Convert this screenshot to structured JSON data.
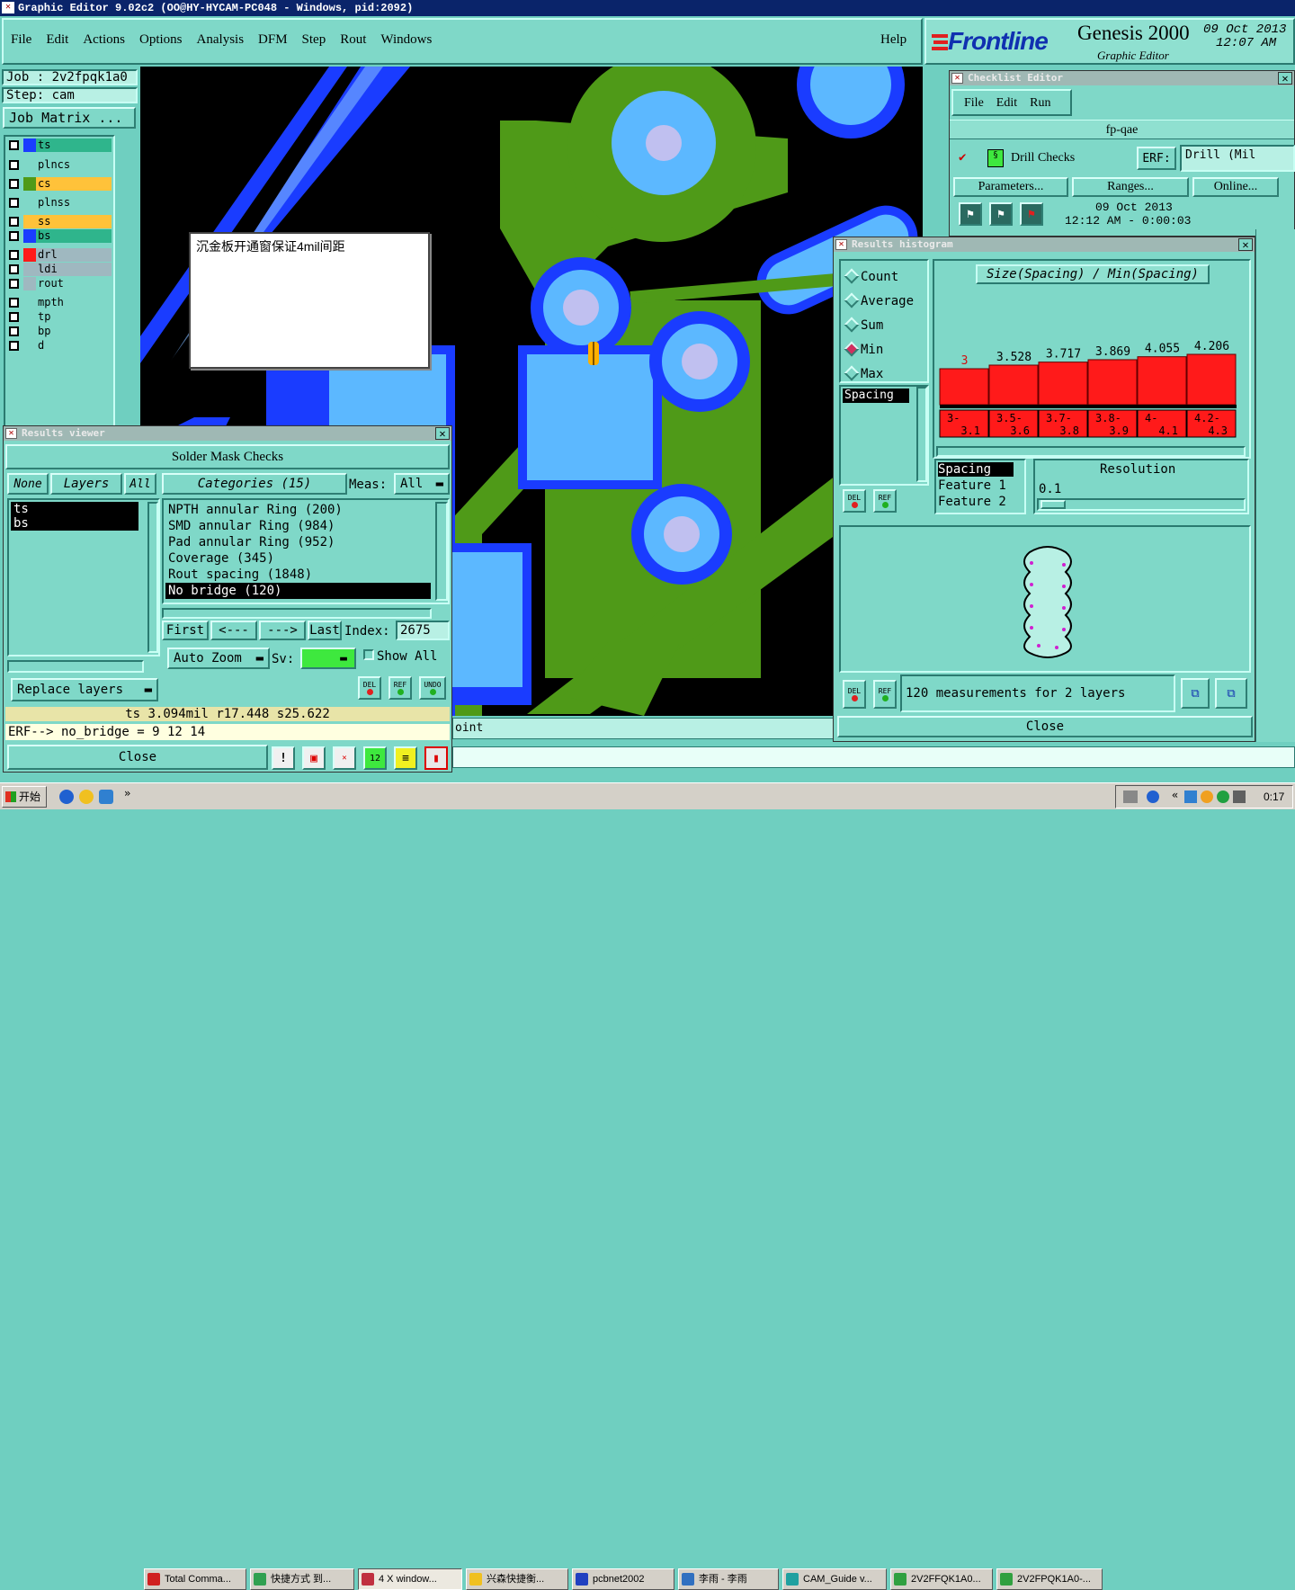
{
  "window": {
    "title": "Graphic Editor 9.02c2 (OO@HY-HYCAM-PC048 - Windows, pid:2092)"
  },
  "menu": [
    "File",
    "Edit",
    "Actions",
    "Options",
    "Analysis",
    "DFM",
    "Step",
    "Rout",
    "Windows"
  ],
  "help": "Help",
  "brand": {
    "logo": "Frontline",
    "product": "Genesis 2000",
    "subtitle": "Graphic Editor",
    "date": "09 Oct 2013",
    "time": "12:07 AM"
  },
  "job": {
    "job": "Job : 2v2fpqk1a0",
    "step": "Step: cam",
    "matrix": "Job Matrix ..."
  },
  "layers": [
    {
      "name": "ts",
      "sw": "#1a3cff",
      "bg": "#2fb58c"
    },
    {
      "name": "plncs",
      "sw": "#7fd8c8",
      "bg": "#7fd8c8"
    },
    {
      "name": "cs",
      "sw": "#4f9a18",
      "bg": "#ffc23a"
    },
    {
      "name": "plnss",
      "sw": "#7fd8c8",
      "bg": "#7fd8c8"
    },
    {
      "name": "ss",
      "sw": "#ffc23a",
      "bg": "#ffc23a"
    },
    {
      "name": "bs",
      "sw": "#1a3cff",
      "bg": "#2fb58c"
    },
    {
      "name": "drl",
      "sw": "#ff1a1a",
      "bg": "#9fb8c0"
    },
    {
      "name": "ldi",
      "sw": "#9fb8c0",
      "bg": "#9fb8c0"
    },
    {
      "name": "rout",
      "sw": "#9fb8c0",
      "bg": "#7fd8c8"
    },
    {
      "name": "mpth",
      "sw": "#7fd8c8",
      "bg": "#7fd8c8"
    },
    {
      "name": "tp",
      "sw": "#7fd8c8",
      "bg": "#7fd8c8"
    },
    {
      "name": "bp",
      "sw": "#7fd8c8",
      "bg": "#7fd8c8"
    },
    {
      "name": "d",
      "sw": "#7fd8c8",
      "bg": "#7fd8c8"
    }
  ],
  "note": {
    "text": "沉金板开通窗保证4mil间距"
  },
  "results": {
    "title": "Results viewer",
    "header": "Solder Mask Checks",
    "none": "None",
    "layers_btn": "Layers",
    "all_btn": "All",
    "layer_items": [
      "ts",
      "bs"
    ],
    "categories": "Categories (15)",
    "meas_label": "Meas:",
    "meas_value": "All",
    "cats": [
      "NPTH annular Ring (200)",
      "SMD annular Ring (984)",
      "Pad annular Ring (952)",
      "Coverage (345)",
      "Rout spacing (1848)",
      "No bridge (120)"
    ],
    "first": "First",
    "prev": "<---",
    "next": "--->",
    "last": "Last",
    "index_label": "Index:",
    "index_value": "2675",
    "autozoom": "Auto Zoom",
    "sv": "Sv:",
    "showall": "Show All",
    "replace": "Replace layers",
    "del": "DEL",
    "ref": "REF",
    "undo": "UNDO",
    "status": "ts 3.094mil  r17.448  s25.622",
    "erf": "ERF--> no_bridge = 9 12 14",
    "close": "Close"
  },
  "checklist": {
    "title": "Checklist Editor",
    "menu": [
      "File",
      "Edit",
      "Run"
    ],
    "name": "fp-qae",
    "check": "Drill Checks",
    "erf_label": "ERF:",
    "erf_value": "Drill (Mil",
    "params": "Parameters...",
    "ranges": "Ranges...",
    "online": "Online...",
    "date": "09 Oct 2013",
    "time": "12:12 AM - 0:00:03"
  },
  "histogram": {
    "title": "Results histogram",
    "modes": [
      "Count",
      "Average",
      "Sum",
      "Min",
      "Max"
    ],
    "selected": "Min",
    "list_item": "Spacing",
    "chart_title": "Size(Spacing) / Min(Spacing)",
    "info_labels": [
      "Spacing",
      "Feature 1",
      "Feature 2"
    ],
    "resolution_label": "Resolution",
    "resolution_value": "0.1",
    "summary": "120 measurements for 2 layers",
    "close": "Close",
    "del": "DEL",
    "ref": "REF"
  },
  "chart_data": {
    "type": "bar",
    "title": "Size(Spacing) / Min(Spacing)",
    "categories": [
      "3-\n3.1",
      "3.5-\n3.6",
      "3.7-\n3.8",
      "3.8-\n3.9",
      "4-\n4.1",
      "4.2-\n4.3"
    ],
    "value_labels": [
      "3",
      "3.528",
      "3.717",
      "3.869",
      "4.055",
      "4.206"
    ],
    "values": [
      3.0,
      3.528,
      3.717,
      3.869,
      4.055,
      4.206
    ],
    "ylim": [
      0,
      4.25
    ]
  },
  "bottom_line": "oint",
  "taskbar": {
    "start": "开始",
    "items": [
      "Total Comma...",
      "快捷方式 到...",
      "4 X window...",
      "兴森快捷衡...",
      "pcbnet2002",
      "李雨 - 李雨",
      "CAM_Guide v...",
      "2V2FFQK1A0...",
      "2V2FPQK1A0-..."
    ],
    "clock": "0:17"
  }
}
